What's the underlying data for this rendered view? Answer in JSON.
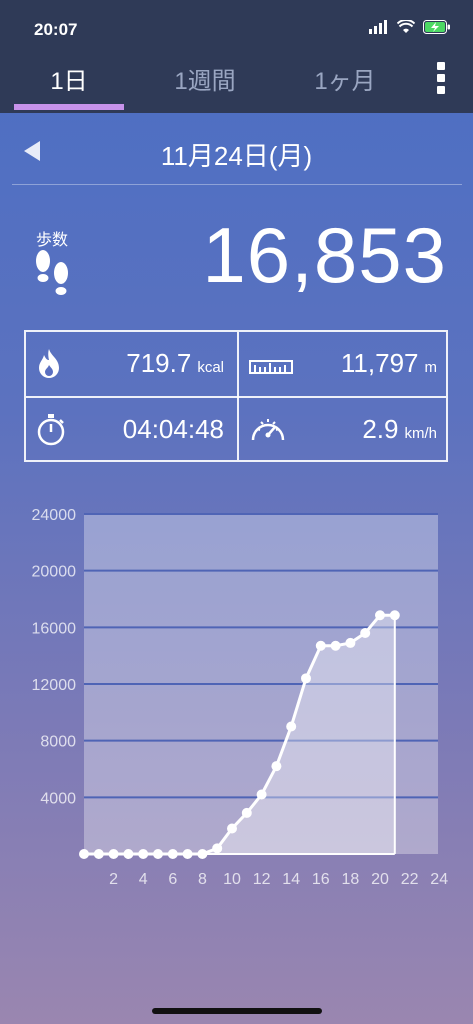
{
  "status": {
    "time": "20:07",
    "icons": [
      "signal-icon",
      "wifi-icon",
      "battery-charging-icon"
    ]
  },
  "tabs": [
    {
      "label": "1日",
      "active": true
    },
    {
      "label": "1週間",
      "active": false
    },
    {
      "label": "1ヶ月",
      "active": false
    }
  ],
  "date": "11月24日(月)",
  "steps": {
    "label": "歩数",
    "value": "16,853"
  },
  "metrics": {
    "calories": {
      "value": "719.7",
      "unit": "kcal"
    },
    "distance": {
      "value": "11,797",
      "unit": "m"
    },
    "duration": {
      "value": "04:04:48"
    },
    "speed": {
      "value": "2.9",
      "unit": "km/h"
    }
  },
  "chart_data": {
    "type": "area",
    "x": [
      0,
      1,
      2,
      3,
      4,
      5,
      6,
      7,
      8,
      9,
      10,
      11,
      12,
      13,
      14,
      15,
      16,
      17,
      18,
      19,
      20,
      21
    ],
    "values": [
      0,
      0,
      0,
      0,
      0,
      0,
      0,
      0,
      0,
      400,
      1800,
      2900,
      4200,
      6200,
      9000,
      12400,
      14700,
      14700,
      14900,
      15600,
      16853,
      16853
    ],
    "xticks": [
      2,
      4,
      6,
      8,
      10,
      12,
      14,
      16,
      18,
      20,
      22,
      24
    ],
    "yticks": [
      4000,
      8000,
      12000,
      16000,
      20000,
      24000
    ],
    "xlim": [
      0,
      24
    ],
    "ylim": [
      0,
      24000
    ],
    "grid": true
  }
}
